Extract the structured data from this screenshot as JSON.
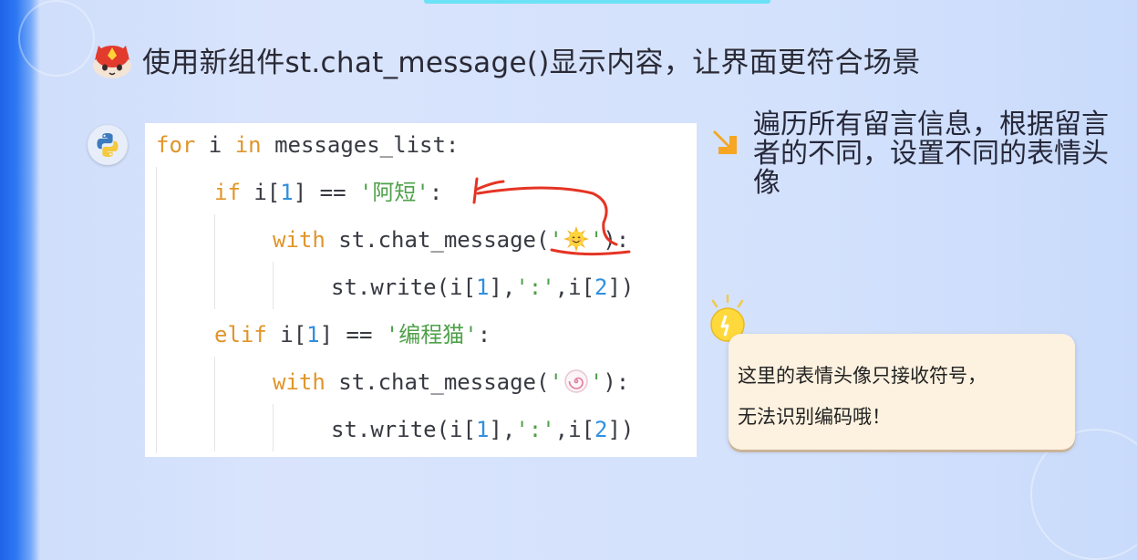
{
  "title": "使用新组件st.chat_message()显示内容，让界面更符合场景",
  "code": {
    "lines": [
      {
        "indent": 0,
        "parts": [
          {
            "t": "kw",
            "v": "for"
          },
          {
            "t": "plain",
            "v": " i "
          },
          {
            "t": "kw",
            "v": "in"
          },
          {
            "t": "plain",
            "v": " messages_list:"
          }
        ]
      },
      {
        "indent": 1,
        "parts": [
          {
            "t": "kw",
            "v": "if"
          },
          {
            "t": "plain",
            "v": " i["
          },
          {
            "t": "num",
            "v": "1"
          },
          {
            "t": "plain",
            "v": "] == "
          },
          {
            "t": "str",
            "v": "'阿短'"
          },
          {
            "t": "plain",
            "v": ":"
          }
        ]
      },
      {
        "indent": 2,
        "parts": [
          {
            "t": "kw",
            "v": "with"
          },
          {
            "t": "plain",
            "v": " st.chat_message("
          },
          {
            "t": "str",
            "v": "'"
          },
          {
            "t": "emoji",
            "v": "sun-smile-emoji"
          },
          {
            "t": "str",
            "v": "'"
          },
          {
            "t": "plain",
            "v": "):"
          }
        ]
      },
      {
        "indent": 3,
        "parts": [
          {
            "t": "plain",
            "v": "st.write(i["
          },
          {
            "t": "num",
            "v": "1"
          },
          {
            "t": "plain",
            "v": "],"
          },
          {
            "t": "str",
            "v": "':'"
          },
          {
            "t": "plain",
            "v": ",i["
          },
          {
            "t": "num",
            "v": "2"
          },
          {
            "t": "plain",
            "v": "])"
          }
        ]
      },
      {
        "indent": 1,
        "parts": [
          {
            "t": "kw",
            "v": "elif"
          },
          {
            "t": "plain",
            "v": " i["
          },
          {
            "t": "num",
            "v": "1"
          },
          {
            "t": "plain",
            "v": "] == "
          },
          {
            "t": "str",
            "v": "'编程猫'"
          },
          {
            "t": "plain",
            "v": ":"
          }
        ]
      },
      {
        "indent": 2,
        "parts": [
          {
            "t": "kw",
            "v": "with"
          },
          {
            "t": "plain",
            "v": " st.chat_message("
          },
          {
            "t": "str",
            "v": "'"
          },
          {
            "t": "emoji",
            "v": "fishcake-emoji"
          },
          {
            "t": "str",
            "v": "'"
          },
          {
            "t": "plain",
            "v": "):"
          }
        ]
      },
      {
        "indent": 3,
        "parts": [
          {
            "t": "plain",
            "v": "st.write(i["
          },
          {
            "t": "num",
            "v": "1"
          },
          {
            "t": "plain",
            "v": "],"
          },
          {
            "t": "str",
            "v": "':'"
          },
          {
            "t": "plain",
            "v": ",i["
          },
          {
            "t": "num",
            "v": "2"
          },
          {
            "t": "plain",
            "v": "])"
          }
        ]
      }
    ]
  },
  "note": "遍历所有留言信息，根据留言者的不同，设置不同的表情头像",
  "tip": {
    "line1": "这里的表情头像只接收符号，",
    "line2": "无法识别编码哦！"
  },
  "icons": {
    "mascot": "red-cat-mascot-icon",
    "python": "python-logo-icon",
    "arrow": "arrow-down-right-icon",
    "bulb": "lightbulb-icon"
  },
  "colors": {
    "keyword": "#e0952a",
    "string": "#4fa14a",
    "number": "#2f8fe0",
    "annotation": "#e53424",
    "arrow": "#f6a623"
  }
}
